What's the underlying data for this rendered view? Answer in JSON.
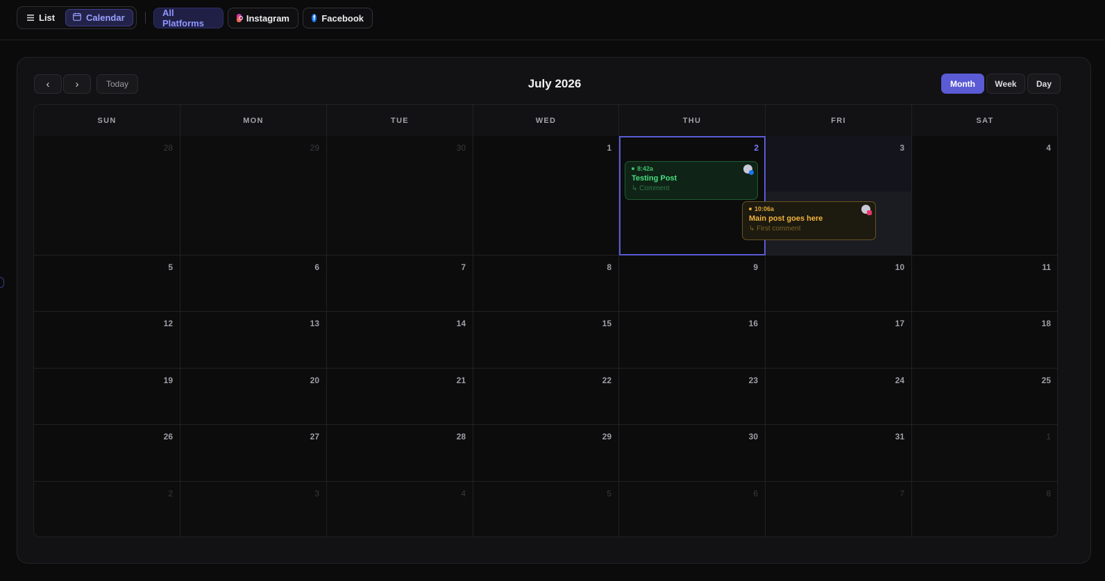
{
  "toolbar": {
    "view_list": "List",
    "view_calendar": "Calendar",
    "filter_all": "All Platforms",
    "filter_instagram": "Instagram",
    "filter_facebook": "Facebook"
  },
  "calendar": {
    "title": "July 2026",
    "today_label": "Today",
    "prev_label": "‹",
    "next_label": "›",
    "ranges": {
      "month": "Month",
      "week": "Week",
      "day": "Day"
    },
    "active_range": "Month",
    "weekdays": [
      "SUN",
      "MON",
      "TUE",
      "WED",
      "THU",
      "FRI",
      "SAT"
    ],
    "weeks": [
      [
        {
          "d": "28",
          "out": true
        },
        {
          "d": "29",
          "out": true
        },
        {
          "d": "30",
          "out": true
        },
        {
          "d": "1"
        },
        {
          "d": "2",
          "today": true
        },
        {
          "d": "3",
          "hl": true
        },
        {
          "d": "4"
        }
      ],
      [
        {
          "d": "5"
        },
        {
          "d": "6"
        },
        {
          "d": "7"
        },
        {
          "d": "8"
        },
        {
          "d": "9"
        },
        {
          "d": "10"
        },
        {
          "d": "11"
        }
      ],
      [
        {
          "d": "12"
        },
        {
          "d": "13"
        },
        {
          "d": "14"
        },
        {
          "d": "15"
        },
        {
          "d": "16"
        },
        {
          "d": "17"
        },
        {
          "d": "18"
        }
      ],
      [
        {
          "d": "19"
        },
        {
          "d": "20"
        },
        {
          "d": "21"
        },
        {
          "d": "22"
        },
        {
          "d": "23"
        },
        {
          "d": "24"
        },
        {
          "d": "25"
        }
      ],
      [
        {
          "d": "26"
        },
        {
          "d": "27"
        },
        {
          "d": "28"
        },
        {
          "d": "29"
        },
        {
          "d": "30"
        },
        {
          "d": "31"
        },
        {
          "d": "1",
          "out": true
        }
      ],
      [
        {
          "d": "2",
          "out": true
        },
        {
          "d": "3",
          "out": true
        },
        {
          "d": "4",
          "out": true
        },
        {
          "d": "5",
          "out": true
        },
        {
          "d": "6",
          "out": true
        },
        {
          "d": "7",
          "out": true
        },
        {
          "d": "8",
          "out": true
        }
      ]
    ],
    "events": {
      "testing": {
        "time": "8:42a",
        "title": "Testing Post",
        "sub": "↳ Comment",
        "platform": "facebook",
        "color": "#4ade80"
      },
      "main": {
        "time": "10:06a",
        "title": "Main post goes here",
        "sub": "↳ First comment",
        "platform": "instagram",
        "color": "#f3b53f"
      }
    }
  },
  "colors": {
    "accent": "#5b5bd6",
    "background": "#0b0b0c"
  }
}
